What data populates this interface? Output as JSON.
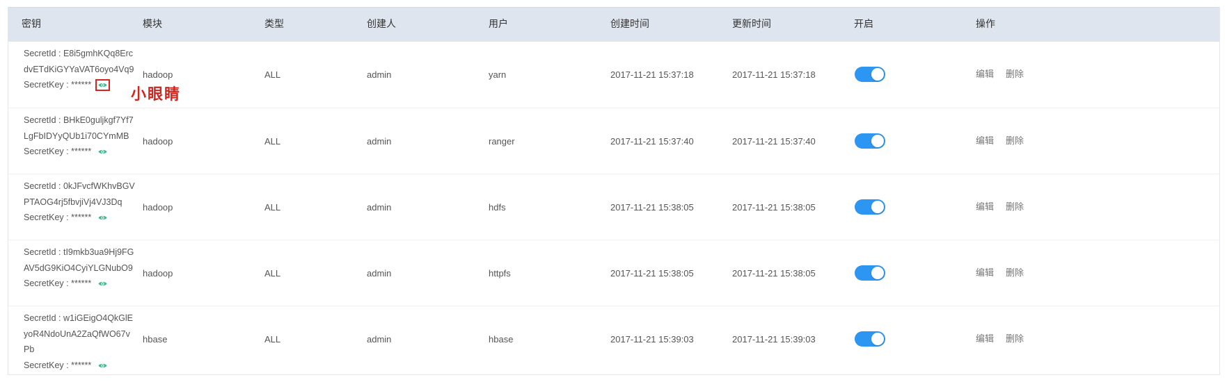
{
  "headers": [
    "密钥",
    "模块",
    "类型",
    "创建人",
    "用户",
    "创建时间",
    "更新时间",
    "开启",
    "操作"
  ],
  "secretkey_label": "SecretKey : ******",
  "edit_label": "编辑",
  "delete_label": "删除",
  "callout_text": "小眼睛",
  "colors": {
    "header_bg": "#dfe5ee",
    "toggle_on": "#2d95f2",
    "eye_icon": "#3fb58b",
    "callout": "#d2251e"
  },
  "rows": [
    {
      "secret_id": "SecretId : E8i5gmhKQq8ErcdvETdKiGYYaVAT6oyo4Vq9",
      "module": "hadoop",
      "type": "ALL",
      "creator": "admin",
      "user": "yarn",
      "created": "2017-11-21 15:37:18",
      "updated": "2017-11-21 15:37:18",
      "enabled": true
    },
    {
      "secret_id": "SecretId : BHkE0guljkgf7Yf7LgFbIDYyQUb1i70CYmMB",
      "module": "hadoop",
      "type": "ALL",
      "creator": "admin",
      "user": "ranger",
      "created": "2017-11-21 15:37:40",
      "updated": "2017-11-21 15:37:40",
      "enabled": true
    },
    {
      "secret_id": "SecretId : 0kJFvcfWKhvBGVPTAOG4rj5fbvjiVj4VJ3Dq",
      "module": "hadoop",
      "type": "ALL",
      "creator": "admin",
      "user": "hdfs",
      "created": "2017-11-21 15:38:05",
      "updated": "2017-11-21 15:38:05",
      "enabled": true
    },
    {
      "secret_id": "SecretId : tI9mkb3ua9Hj9FGAV5dG9KiO4CyiYLGNubO9",
      "module": "hadoop",
      "type": "ALL",
      "creator": "admin",
      "user": "httpfs",
      "created": "2017-11-21 15:38:05",
      "updated": "2017-11-21 15:38:05",
      "enabled": true
    },
    {
      "secret_id": "SecretId : w1iGEigO4QkGlEyoR4NdoUnA2ZaQfWO67vPb",
      "module": "hbase",
      "type": "ALL",
      "creator": "admin",
      "user": "hbase",
      "created": "2017-11-21 15:39:03",
      "updated": "2017-11-21 15:39:03",
      "enabled": true
    }
  ]
}
